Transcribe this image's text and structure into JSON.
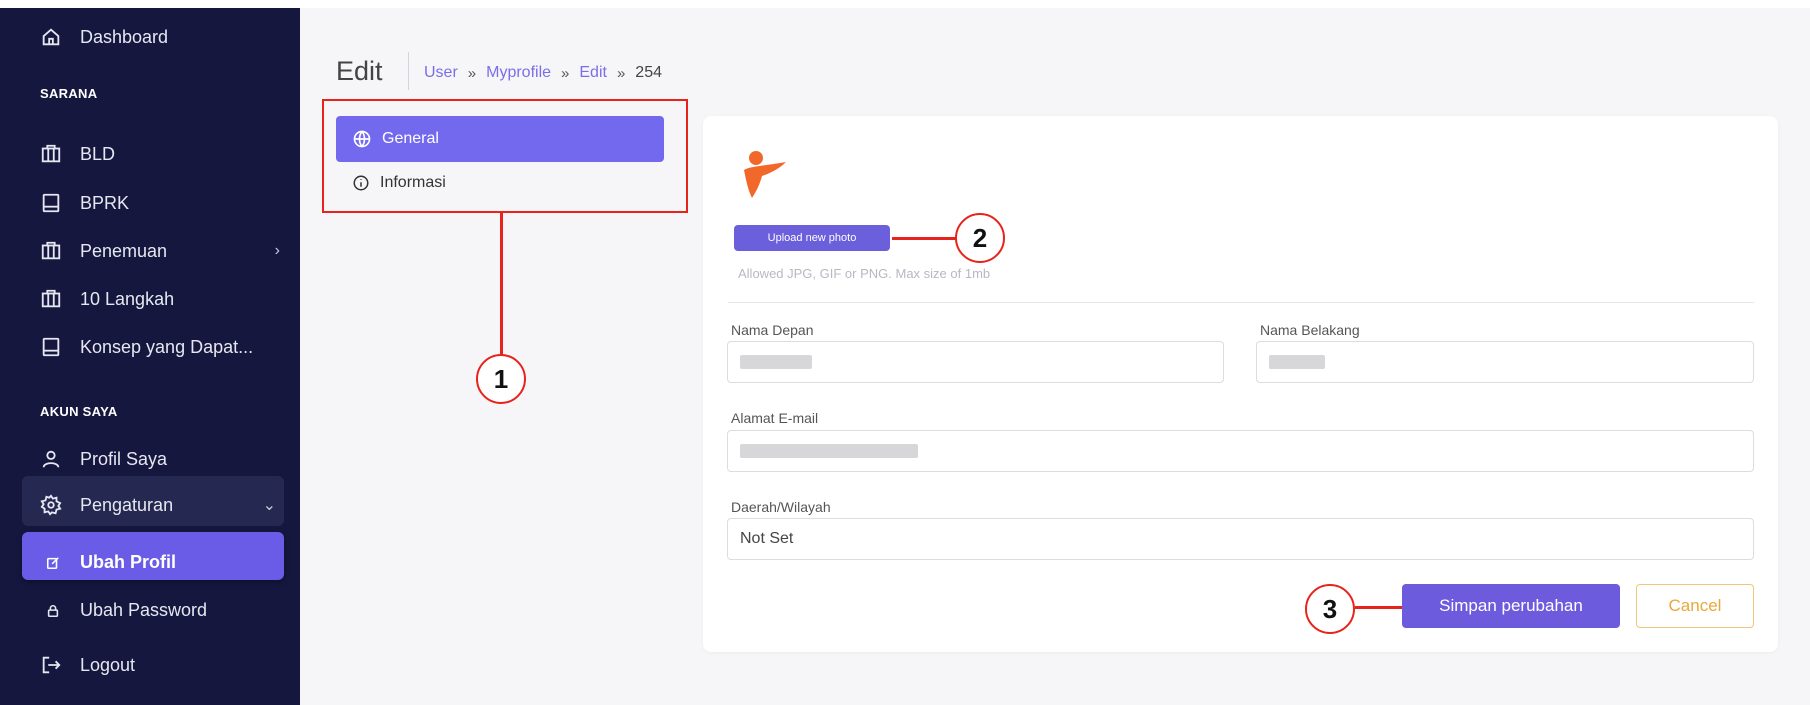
{
  "sidebar": {
    "dashboard": "Dashboard",
    "section_sarana": "SARANA",
    "items": [
      "BLD",
      "BPRK",
      "Penemuan",
      "10 Langkah",
      "Konsep yang Dapat..."
    ],
    "section_akun": "AKUN SAYA",
    "profil": "Profil Saya",
    "pengaturan": "Pengaturan",
    "ubah_profil": "Ubah Profil",
    "ubah_password": "Ubah Password",
    "logout": "Logout"
  },
  "header": {
    "title": "Edit",
    "breadcrumb": [
      "User",
      "Myprofile",
      "Edit",
      "254"
    ],
    "breadcrumb_sep": "»"
  },
  "tabs": {
    "general": "General",
    "informasi": "Informasi"
  },
  "form": {
    "upload_label": "Upload new photo",
    "upload_hint": "Allowed JPG, GIF or PNG. Max size of 1mb",
    "nama_depan_label": "Nama Depan",
    "nama_belakang_label": "Nama Belakang",
    "email_label": "Alamat E-mail",
    "daerah_label": "Daerah/Wilayah",
    "daerah_value": "Not Set",
    "save_label": "Simpan perubahan",
    "cancel_label": "Cancel"
  },
  "annotations": [
    "1",
    "2",
    "3"
  ],
  "colors": {
    "sidebar_bg": "#15173f",
    "accent": "#6c5bdc",
    "annotation": "#e8231b",
    "cancel": "#e7a83a",
    "logo": "#f2672a"
  }
}
